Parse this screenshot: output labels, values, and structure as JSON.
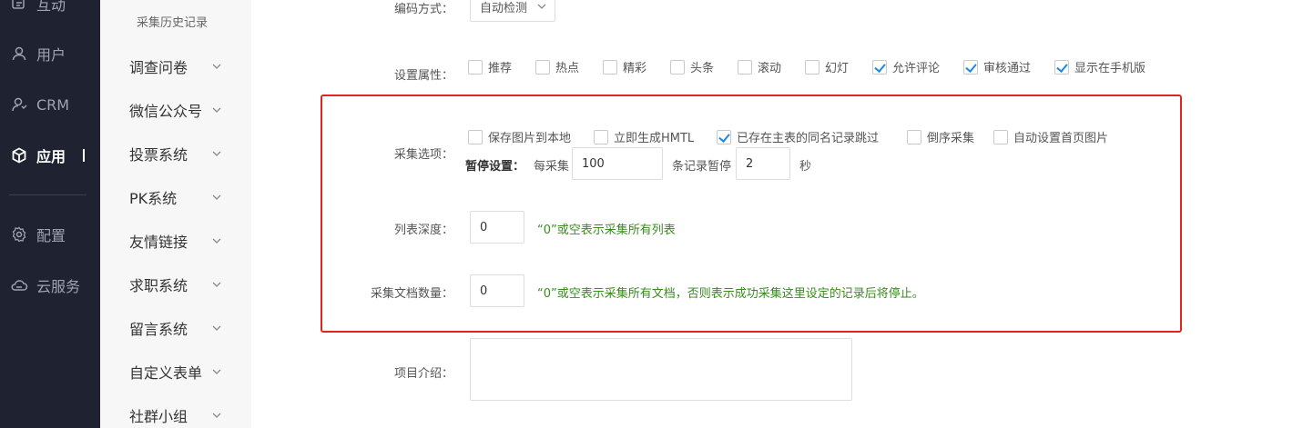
{
  "nav": {
    "items": [
      {
        "label": "互动",
        "icon": "interaction-icon"
      },
      {
        "label": "用户",
        "icon": "user-icon"
      },
      {
        "label": "CRM",
        "icon": "crm-icon"
      },
      {
        "label": "应用",
        "icon": "app-cube-icon",
        "active": true
      },
      {
        "label": "配置",
        "icon": "gear-icon"
      },
      {
        "label": "云服务",
        "icon": "cloud-icon"
      }
    ]
  },
  "submenu": {
    "header": "采集历史记录",
    "items": [
      {
        "label": "调查问卷"
      },
      {
        "label": "微信公众号"
      },
      {
        "label": "投票系统"
      },
      {
        "label": "PK系统"
      },
      {
        "label": "友情链接"
      },
      {
        "label": "求职系统"
      },
      {
        "label": "留言系统"
      },
      {
        "label": "自定义表单"
      },
      {
        "label": "社群小组"
      }
    ]
  },
  "form": {
    "encoding": {
      "label": "编码方式：",
      "value": "自动检测"
    },
    "attributes": {
      "label": "设置属性：",
      "options": [
        {
          "label": "推荐",
          "checked": false
        },
        {
          "label": "热点",
          "checked": false
        },
        {
          "label": "精彩",
          "checked": false
        },
        {
          "label": "头条",
          "checked": false
        },
        {
          "label": "滚动",
          "checked": false
        },
        {
          "label": "幻灯",
          "checked": false
        },
        {
          "label": "允许评论",
          "checked": true
        },
        {
          "label": "审核通过",
          "checked": true
        },
        {
          "label": "显示在手机版",
          "checked": true
        }
      ]
    },
    "collect_options": {
      "label": "采集选项：",
      "options": [
        {
          "label": "保存图片到本地",
          "checked": false
        },
        {
          "label": "立即生成HMTL",
          "checked": false
        },
        {
          "label": "已存在主表的同名记录跳过",
          "checked": true
        },
        {
          "label": "倒序采集",
          "checked": false
        },
        {
          "label": "自动设置首页图片",
          "checked": false
        }
      ]
    },
    "pause": {
      "title": "暂停设置：",
      "prefix": "每采集",
      "count": "100",
      "middle": "条记录暂停",
      "seconds": "2",
      "suffix": "秒"
    },
    "list_depth": {
      "label": "列表深度：",
      "value": "0",
      "hint": "“0”或空表示采集所有列表"
    },
    "doc_count": {
      "label": "采集文档数量：",
      "value": "0",
      "hint": "“0”或空表示采集所有文档，否则表示成功采集这里设定的记录后将停止。"
    },
    "intro": {
      "label": "项目介绍："
    }
  },
  "colors": {
    "highlight_border": "#e1251b",
    "check": "#1e88e5",
    "hint": "#3a8a20",
    "nav_bg": "#1f2230"
  }
}
